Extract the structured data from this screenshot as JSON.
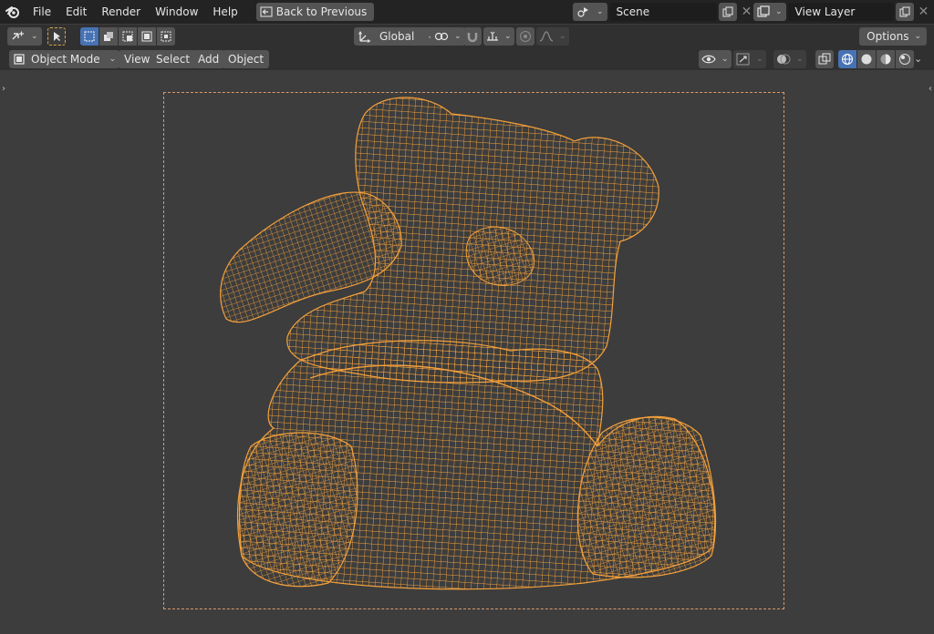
{
  "topbar": {
    "menu": [
      "File",
      "Edit",
      "Render",
      "Window",
      "Help"
    ],
    "back_button": "Back to Previous",
    "scene_name": "Scene",
    "view_layer_name": "View Layer"
  },
  "toolbar": {
    "orientation": "Global",
    "options_label": "Options"
  },
  "header": {
    "mode": "Object Mode",
    "menus": [
      "View",
      "Select",
      "Add",
      "Object"
    ]
  },
  "colors": {
    "accent": "#4772b3",
    "wire": "#f5a13a",
    "camera_frame": "#d99a6c"
  },
  "viewport": {
    "object": "teddy bear wireframe mesh"
  }
}
